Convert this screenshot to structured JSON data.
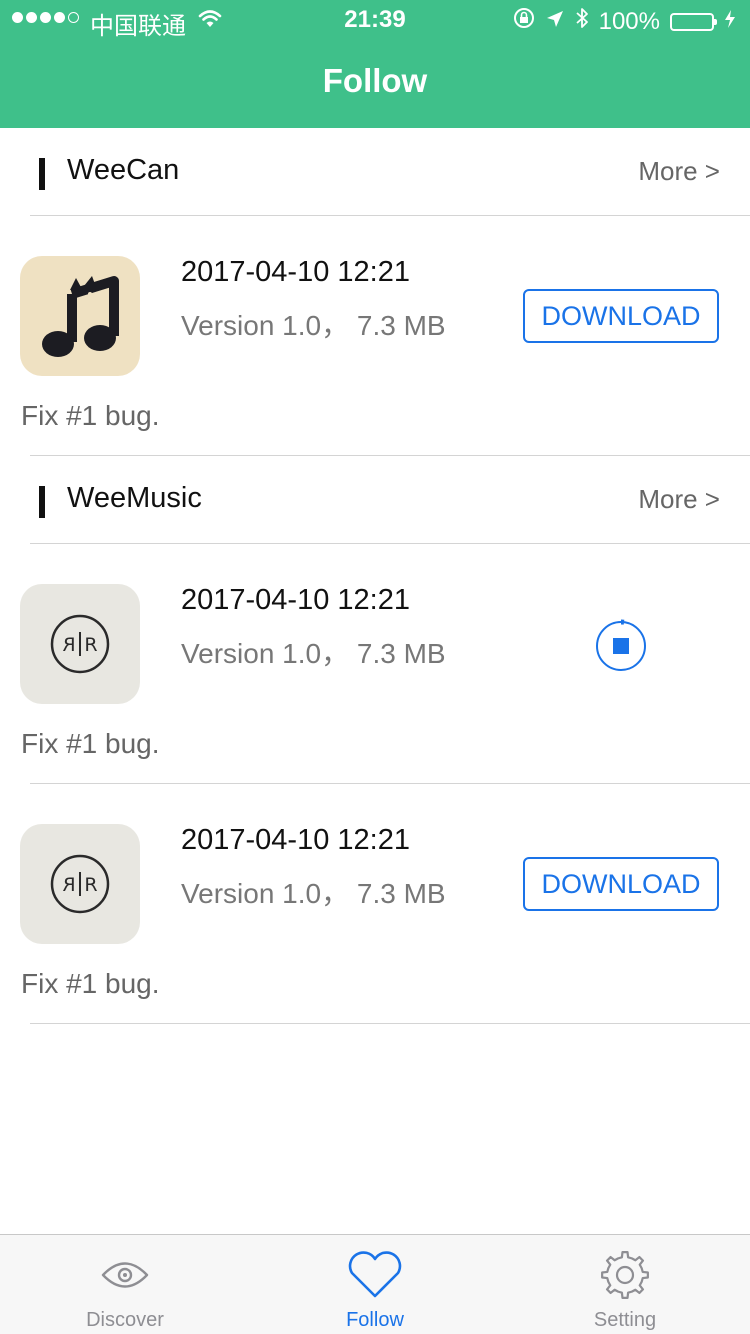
{
  "status_bar": {
    "carrier": "中国联通",
    "time": "21:39",
    "battery": "100%",
    "battery_level": 1.0
  },
  "nav": {
    "title": "Follow"
  },
  "sections": [
    {
      "name": "WeeCan",
      "more": "More >",
      "items": [
        {
          "icon": "weecan-music-note-icon",
          "date": "2017-04-10 12:21",
          "version": "Version 1.0，  7.3 MB",
          "notes": "Fix #1 bug.",
          "action": "download",
          "action_label": "DOWNLOAD"
        }
      ]
    },
    {
      "name": "WeeMusic",
      "more": "More >",
      "items": [
        {
          "icon": "rr-logo-icon",
          "date": "2017-04-10 12:21",
          "version": "Version 1.0，  7.3 MB",
          "notes": "Fix #1 bug.",
          "action": "downloading",
          "progress": 0.02
        },
        {
          "icon": "rr-logo-icon",
          "date": "2017-04-10 12:21",
          "version": "Version 1.0，  7.3 MB",
          "notes": "Fix #1 bug.",
          "action": "download",
          "action_label": "DOWNLOAD"
        }
      ]
    }
  ],
  "tabs": [
    {
      "label": "Discover",
      "icon": "eye-icon",
      "active": false
    },
    {
      "label": "Follow",
      "icon": "heart-icon",
      "active": true
    },
    {
      "label": "Setting",
      "icon": "gear-icon",
      "active": false
    }
  ],
  "colors": {
    "nav_green": "#3fc08a",
    "accent_blue": "#1a73e8",
    "battery_green": "#4cd964"
  }
}
